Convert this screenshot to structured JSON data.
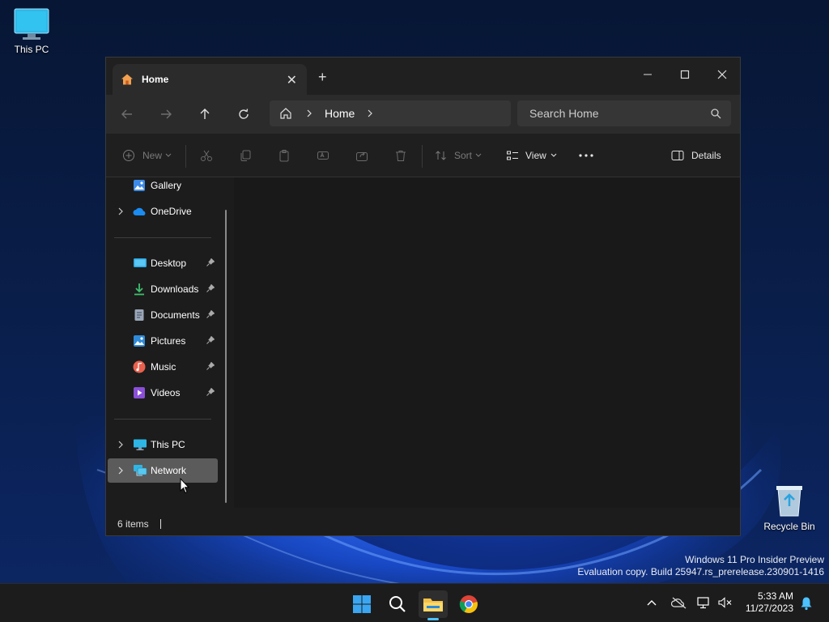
{
  "desktop": {
    "icons": [
      {
        "label": "This PC"
      },
      {
        "label": "Recycle Bin"
      }
    ],
    "watermark": {
      "line1": "Windows 11 Pro Insider Preview",
      "line2": "Evaluation copy. Build 25947.rs_prerelease.230901-1416"
    }
  },
  "explorer": {
    "tab": {
      "label": "Home",
      "icon": "home-icon"
    },
    "window_controls": [
      "minimize",
      "maximize",
      "close"
    ],
    "breadcrumb": [
      "Home"
    ],
    "search": {
      "placeholder": "Search Home"
    },
    "toolbar": {
      "new_label": "New",
      "sort_label": "Sort",
      "view_label": "View",
      "details_label": "Details"
    },
    "sidebar": {
      "items": [
        {
          "label": "Gallery",
          "icon": "gallery-icon",
          "expandable": false,
          "pinned": false
        },
        {
          "label": "OneDrive",
          "icon": "onedrive-icon",
          "expandable": true,
          "pinned": false
        },
        {
          "label": "Desktop",
          "icon": "desktop-folder-icon",
          "expandable": false,
          "pinned": true
        },
        {
          "label": "Downloads",
          "icon": "downloads-icon",
          "expandable": false,
          "pinned": true
        },
        {
          "label": "Documents",
          "icon": "documents-icon",
          "expandable": false,
          "pinned": true
        },
        {
          "label": "Pictures",
          "icon": "pictures-icon",
          "expandable": false,
          "pinned": true
        },
        {
          "label": "Music",
          "icon": "music-icon",
          "expandable": false,
          "pinned": true
        },
        {
          "label": "Videos",
          "icon": "videos-icon",
          "expandable": false,
          "pinned": true
        },
        {
          "label": "This PC",
          "icon": "this-pc-icon",
          "expandable": true,
          "pinned": false
        },
        {
          "label": "Network",
          "icon": "network-icon",
          "expandable": true,
          "pinned": false,
          "hovered": true
        }
      ]
    },
    "status": {
      "item_count": "6 items"
    }
  },
  "taskbar": {
    "apps": [
      "start",
      "search",
      "file-explorer",
      "chrome"
    ],
    "active_app": "file-explorer",
    "clock": {
      "time": "5:33 AM",
      "date": "11/27/2023"
    }
  },
  "colors": {
    "accent": "#4cc2ff",
    "window_bg": "#1c1c1c",
    "selection": "#5b5b5b"
  }
}
